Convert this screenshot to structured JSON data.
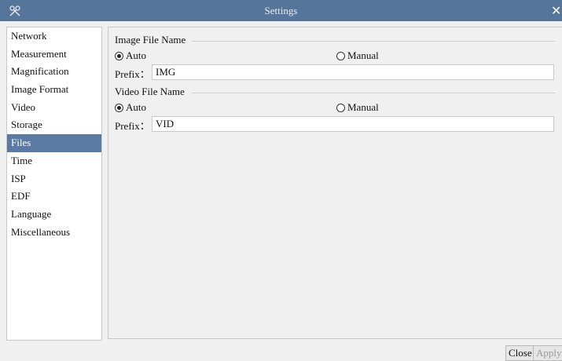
{
  "window": {
    "title": "Settings",
    "close_symbol": "✕"
  },
  "sidebar": {
    "items": [
      {
        "label": "Network"
      },
      {
        "label": "Measurement"
      },
      {
        "label": "Magnification"
      },
      {
        "label": "Image Format"
      },
      {
        "label": "Video"
      },
      {
        "label": "Storage"
      },
      {
        "label": "Files",
        "active": true
      },
      {
        "label": "Time"
      },
      {
        "label": "ISP"
      },
      {
        "label": "EDF"
      },
      {
        "label": "Language"
      },
      {
        "label": "Miscellaneous"
      }
    ]
  },
  "image_file": {
    "title": "Image File Name",
    "auto_label": "Auto",
    "manual_label": "Manual",
    "selected": "Auto",
    "prefix_label": "Prefix：",
    "prefix_value": "IMG"
  },
  "video_file": {
    "title": "Video File Name",
    "auto_label": "Auto",
    "manual_label": "Manual",
    "selected": "Auto",
    "prefix_label": "Prefix：",
    "prefix_value": "VID"
  },
  "buttons": {
    "close": "Close",
    "apply": "Apply"
  },
  "colors": {
    "titlebar": "#55759a",
    "selected_item": "#5b7aa3"
  }
}
